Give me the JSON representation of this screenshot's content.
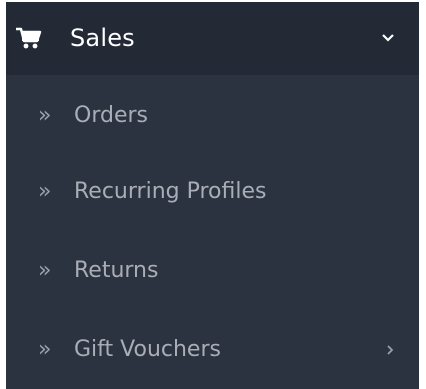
{
  "menu": {
    "header": {
      "label": "Sales",
      "icon": "shopping-cart-icon",
      "toggle_icon": "chevron-down-icon"
    },
    "items": [
      {
        "label": "Orders",
        "icon": "double-chevron-right-icon"
      },
      {
        "label": "Recurring Profiles",
        "icon": "double-chevron-right-icon"
      },
      {
        "label": "Returns",
        "icon": "double-chevron-right-icon"
      },
      {
        "label": "Gift Vouchers",
        "icon": "double-chevron-right-icon",
        "submenu_icon": "chevron-right-icon"
      }
    ]
  },
  "colors": {
    "header_bg": "#232a36",
    "panel_bg": "#2b3240",
    "header_text": "#ffffff",
    "item_text": "#a9adb5"
  }
}
